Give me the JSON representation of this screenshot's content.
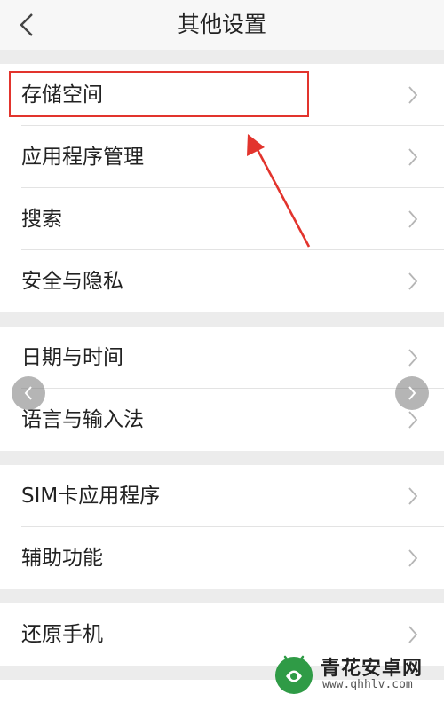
{
  "header": {
    "title": "其他设置"
  },
  "groups": [
    {
      "items": [
        {
          "label": "存储空间"
        },
        {
          "label": "应用程序管理"
        },
        {
          "label": "搜索"
        },
        {
          "label": "安全与隐私"
        }
      ]
    },
    {
      "items": [
        {
          "label": "日期与时间"
        },
        {
          "label": "语言与输入法"
        }
      ]
    },
    {
      "items": [
        {
          "label": "SIM卡应用程序"
        },
        {
          "label": "辅助功能"
        }
      ]
    },
    {
      "items": [
        {
          "label": "还原手机"
        }
      ]
    }
  ],
  "watermark": {
    "name": "青花安卓网",
    "url": "www.qhhlv.com"
  },
  "colors": {
    "highlight": "#e2342d",
    "chevron": "#b5b5b5"
  }
}
